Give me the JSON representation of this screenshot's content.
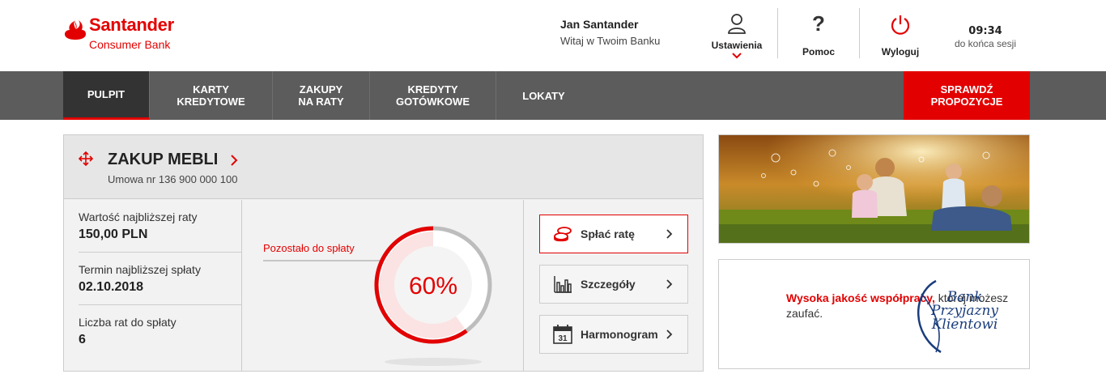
{
  "brand": {
    "name": "Santander",
    "subname": "Consumer Bank",
    "accent": "#e30000"
  },
  "user": {
    "name": "Jan Santander",
    "greeting": "Witaj w Twoim Banku"
  },
  "header_actions": [
    {
      "label": "Ustawienia",
      "icon": "user-icon"
    },
    {
      "label": "Pomoc",
      "icon": "question-icon"
    },
    {
      "label": "Wyloguj",
      "icon": "power-icon"
    }
  ],
  "session": {
    "time": "09:34",
    "text": "do końca sesji"
  },
  "nav": {
    "items": [
      "PULPIT",
      "KARTY\nKREDYTOWE",
      "ZAKUPY\nNA RATY",
      "KREDYTY\nGOTÓWKOWE",
      "LOKATY"
    ],
    "active_index": 0,
    "cta": "SPRAWDŹ\nPROPOZYCJE"
  },
  "card": {
    "title": "ZAKUP MEBLI",
    "contract": "Umowa nr 136 900 000 100",
    "info": [
      {
        "label": "Wartość najbliższej raty",
        "value": "150,00 PLN"
      },
      {
        "label": "Termin najbliższej spłaty",
        "value": "02.10.2018"
      },
      {
        "label": "Liczba rat do spłaty",
        "value": "6"
      }
    ],
    "remaining_label": "Pozostało do spłaty",
    "remaining_percent_text": "60%",
    "remaining_fraction": 0.6,
    "actions": [
      {
        "label": "Spłać ratę",
        "icon": "coins-icon",
        "primary": true
      },
      {
        "label": "Szczegóły",
        "icon": "bar-chart-icon",
        "primary": false
      },
      {
        "label": "Harmonogram",
        "icon": "calendar-icon",
        "icon_text": "31",
        "primary": false
      }
    ]
  },
  "banner2": {
    "text_red": "Wysoka jakość współpracy,",
    "text_rest": "której możesz zaufać.",
    "logo_lines": [
      "Bank",
      "Przyjazny",
      "Klientowi"
    ]
  }
}
